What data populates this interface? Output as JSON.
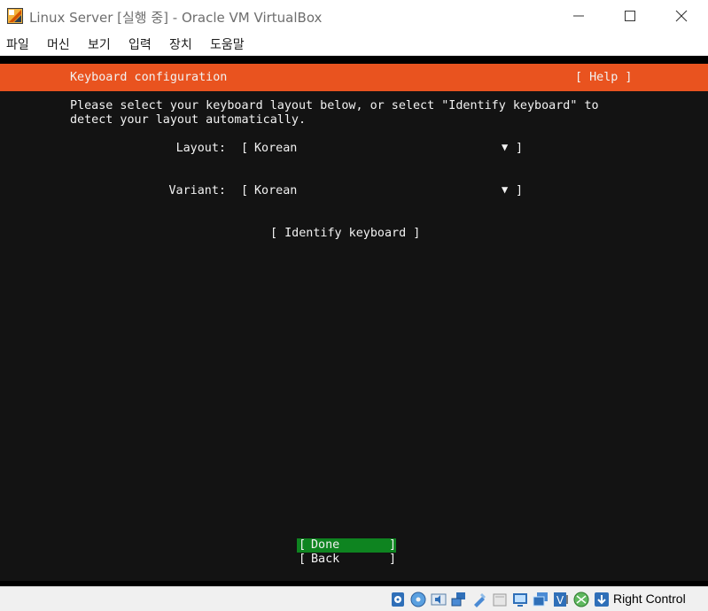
{
  "window": {
    "title": "Linux Server [실행 중] - Oracle VM VirtualBox"
  },
  "menu": [
    {
      "label": "파일"
    },
    {
      "label": "머신"
    },
    {
      "label": "보기"
    },
    {
      "label": "입력"
    },
    {
      "label": "장치"
    },
    {
      "label": "도움말"
    }
  ],
  "installer": {
    "header_title": "Keyboard configuration",
    "help_label": "[ Help ]",
    "description_line1": "Please select your keyboard layout below, or select \"Identify keyboard\" to",
    "description_line2": "detect your layout automatically.",
    "layout_label": "Layout:",
    "layout_value": "Korean",
    "variant_label": "Variant:",
    "variant_value": "Korean",
    "identify_label": "[ Identify keyboard ]",
    "done_label": "Done",
    "back_label": "Back",
    "colors": {
      "header": "#e9531f",
      "background": "#131313",
      "done_button": "#0e8420",
      "text": "#f2f2f2"
    }
  },
  "statusbar": {
    "icons": [
      "hard-disk-icon",
      "optical-drive-icon",
      "audio-icon",
      "network-icon",
      "usb-icon",
      "shared-folders-icon",
      "display-icon",
      "video-capture-icon",
      "virtualization-icon",
      "mouse-integration-icon",
      "keyboard-capture-icon"
    ],
    "host_key": "Right Control"
  }
}
